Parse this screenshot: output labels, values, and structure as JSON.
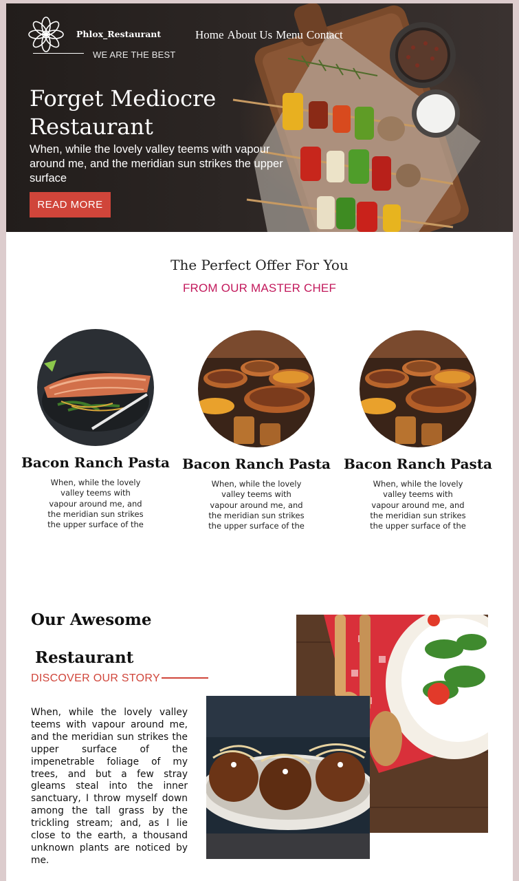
{
  "brand": {
    "name": "Phlox_Restaurant",
    "tagline": "WE ARE THE BEST"
  },
  "nav": [
    "Home",
    "About Us",
    "Menu",
    "Contact"
  ],
  "hero": {
    "title": "Forget Mediocre Restaurant",
    "text": "When, while the lovely valley teems with vapour around me, and the meridian sun strikes the upper surface",
    "button": "READ MORE"
  },
  "offer": {
    "title": "The Perfect Offer For You",
    "subtitle": "FROM OUR MASTER CHEF",
    "cards": [
      {
        "title": "Bacon Ranch Pasta",
        "text": "When, while the lovely valley teems with vapour around me, and the meridian sun strikes the upper surface of the",
        "image": "salmon-dish"
      },
      {
        "title": "Bacon Ranch Pasta",
        "text": "When, while the lovely valley teems with vapour around me, and the meridian sun strikes the upper surface of the",
        "image": "copper-pots-dish"
      },
      {
        "title": "Bacon Ranch Pasta",
        "text": "When, while the lovely valley teems with vapour around me, and the meridian sun strikes the upper surface of the",
        "image": "copper-pots-dish"
      }
    ]
  },
  "story": {
    "title_line1": "Our Awesome",
    "title_line2": "Restaurant",
    "subtitle": "DISCOVER OUR STORY",
    "text": "When, while the lovely valley teems with vapour around me, and the meridian sun strikes the upper surface of the impenetrable foliage of my trees, and but a few stray gleams steal into the inner sanctuary, I throw myself down among the tall grass by the trickling stream; and, as I lie close to the earth, a thousand unknown plants are noticed by me."
  },
  "colors": {
    "accent": "#d0453a",
    "subtitle": "#c2185b",
    "page_bg": "#dccccd"
  }
}
